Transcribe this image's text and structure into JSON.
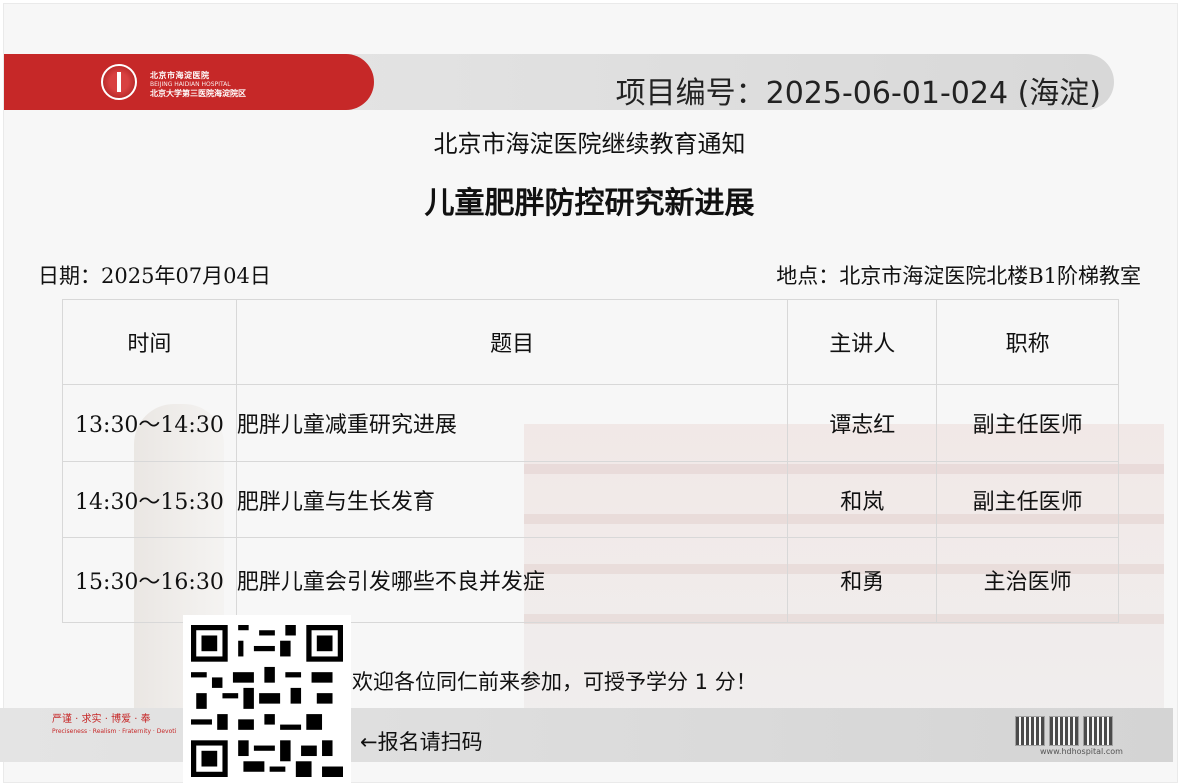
{
  "header": {
    "hospital_name_cn": "北京市海淀医院",
    "hospital_name_en": "BEIJING HAIDIAN HOSPITAL",
    "hospital_subtitle_cn": "北京大学第三医院海淀院区",
    "project_number": "项目编号：2025-06-01-024 (海淀)"
  },
  "notice_title": "北京市海淀医院继续教育通知",
  "main_title": "儿童肥胖防控研究新进展",
  "date": "日期：2025年07月04日",
  "location": "地点：北京市海淀医院北楼B1阶梯教室",
  "table": {
    "headers": [
      "时间",
      "题目",
      "主讲人",
      "职称"
    ],
    "rows": [
      {
        "time": "13:30～14:30",
        "topic": "肥胖儿童减重研究进展",
        "speaker": "谭志红",
        "title": "副主任医师"
      },
      {
        "time": "14:30～15:30",
        "topic": "肥胖儿童与生长发育",
        "speaker": "和岚",
        "title": "副主任医师"
      },
      {
        "time": "15:30～16:30",
        "topic": "肥胖儿童会引发哪些不良并发症",
        "speaker": "和勇",
        "title": "主治医师"
      }
    ]
  },
  "welcome": "欢迎各位同仁前来参加，可授予学分 1 分！",
  "signup": "←报名请扫码",
  "footer": {
    "slogan_cn": "严谨 · 求实 · 博爱 · 奉",
    "slogan_en": "Preciseness · Realism · Fraternity · Devoti",
    "website": "www.hdhospital.com"
  },
  "colors": {
    "brand_red": "#c62828",
    "header_gray": "#dddddd"
  }
}
